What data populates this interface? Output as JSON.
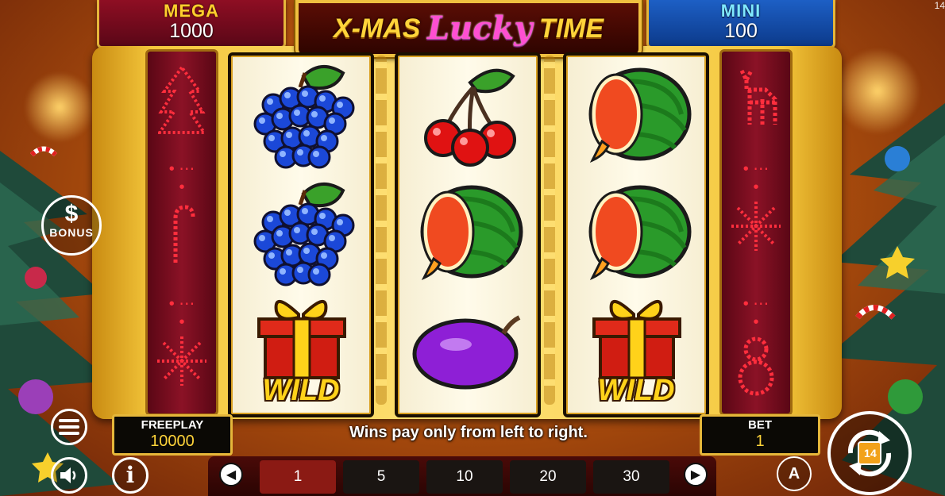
{
  "jackpots": {
    "mega": {
      "title": "MEGA",
      "value": "1000"
    },
    "mini": {
      "title": "MINI",
      "value": "100"
    }
  },
  "logo": {
    "part1": "X-MAS",
    "lucky": "Lucky",
    "part2": "TIME"
  },
  "reels": [
    [
      "grapes",
      "grapes",
      "wild-gift"
    ],
    [
      "cherries",
      "watermelon",
      "plum"
    ],
    [
      "watermelon",
      "watermelon",
      "wild-gift"
    ]
  ],
  "wild_label": "WILD",
  "freeplay": {
    "label": "FREEPLAY",
    "value": "10000"
  },
  "bet": {
    "label": "BET",
    "value": "1"
  },
  "message": "Wins pay only from left to right.",
  "bet_options": [
    "1",
    "5",
    "10",
    "20",
    "30"
  ],
  "selected_bet": "1",
  "bonus_label": "BONUS",
  "clock_fragment": "14",
  "colors": {
    "gold": "#e6b73a",
    "reel_bg": "#fffbea",
    "active_bet": "#8b1a14",
    "mega_bg": "#8e0e23",
    "mini_bg": "#1d5fc5"
  }
}
